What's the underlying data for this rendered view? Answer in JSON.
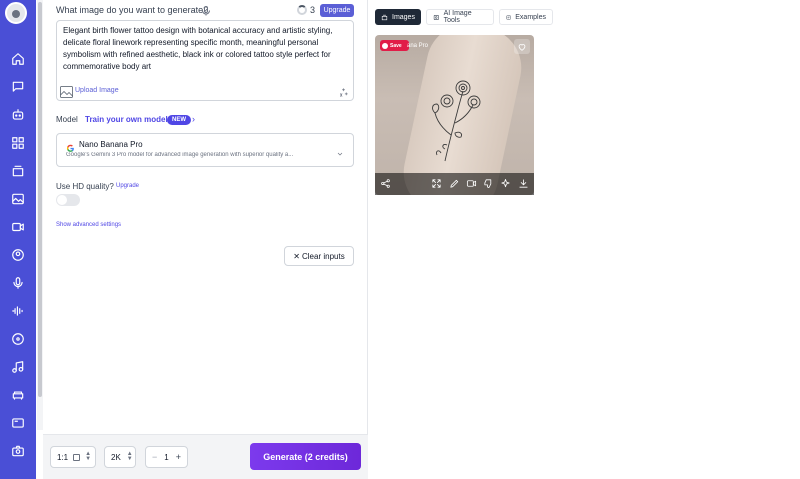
{
  "form": {
    "question": "What image do you want to generate?",
    "credits": "3",
    "upgrade_label": "Upgrade",
    "prompt": "Elegant birth flower tattoo design with botanical accuracy and artistic styling, delicate floral linework representing specific month, meaningful personal symbolism with refined aesthetic, black ink or colored tattoo style perfect for commemorative body art",
    "upload_label": "Upload Image",
    "model_label": "Model",
    "train_label": "Train your own model",
    "new_badge": "NEW",
    "model_name": "Nano Banana Pro",
    "model_desc": "Google's Gemini 3 Pro model for advanced image generation with superior quality a...",
    "hd_label": "Use HD quality?",
    "hd_upgrade": "Upgrade",
    "advanced_label": "Show advanced settings",
    "clear_label": "Clear inputs"
  },
  "bottom": {
    "ratio": "1:1",
    "resolution": "2K",
    "count": "1",
    "minus": "−",
    "plus": "+",
    "generate_label": "Generate (2 credits)"
  },
  "tabs": {
    "images": "Images",
    "tools": "AI Image Tools",
    "examples": "Examples"
  },
  "result": {
    "save_label": "Save",
    "watermark": "ana Pro"
  },
  "colors": {
    "sidebar": "#4a4fd6",
    "accent": "#4f46e5",
    "generate": "#7c3aed",
    "save": "#e11d48"
  },
  "icons": {
    "sidebar": [
      "home-icon",
      "chat-icon",
      "robot-icon",
      "apps-icon",
      "layers-icon",
      "image-icon",
      "video-icon",
      "user-icon",
      "microphone-icon",
      "waveform-icon",
      "disc-icon",
      "music-icon",
      "sofa-icon",
      "gallery-icon",
      "camera-icon"
    ],
    "toolbar": [
      "share-icon",
      "expand-icon",
      "edit-icon",
      "video-icon",
      "thumbs-down-icon",
      "sparkles-icon",
      "download-icon"
    ]
  }
}
